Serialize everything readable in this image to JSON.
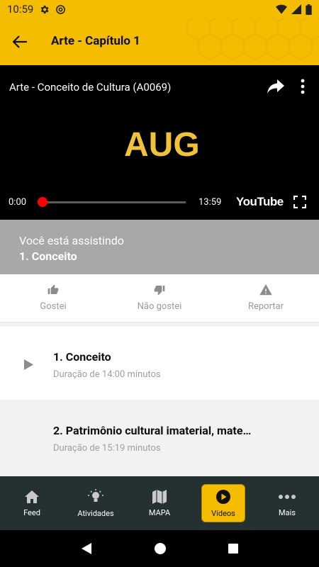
{
  "status_bar": {
    "time": "10:59"
  },
  "app_bar": {
    "title": "Arte - Capítulo 1"
  },
  "video": {
    "title": "Arte - Conceito de Cultura (A0069)",
    "current_time": "0:00",
    "duration": "13:59",
    "progress": 0,
    "platform": "YouTube",
    "logo_text": "AUG"
  },
  "watching": {
    "label": "Você está assistindo",
    "current": "1. Conceito"
  },
  "reactions": [
    {
      "label": "Gostei",
      "icon": "thumbs-up-icon"
    },
    {
      "label": "Não gostei",
      "icon": "thumbs-down-icon"
    },
    {
      "label": "Reportar",
      "icon": "warning-icon"
    }
  ],
  "videos": [
    {
      "title": "1. Conceito",
      "duration": "Duração de 14:00 minutos"
    },
    {
      "title": "2. Patrimônio cultural imaterial, mate…",
      "duration": "Duração de 15:19 minutos"
    }
  ],
  "bottom_nav": [
    {
      "label": "Feed",
      "icon": "home-icon"
    },
    {
      "label": "Atividades",
      "icon": "lightbulb-icon"
    },
    {
      "label": "MAPA",
      "icon": "map-icon"
    },
    {
      "label": "Vídeos",
      "icon": "play-circle-icon"
    },
    {
      "label": "Mais",
      "icon": "more-dots-icon"
    }
  ],
  "colors": {
    "accent": "#f5bd00",
    "nav_bg": "#243130",
    "banner_bg": "#a8a8a8"
  }
}
